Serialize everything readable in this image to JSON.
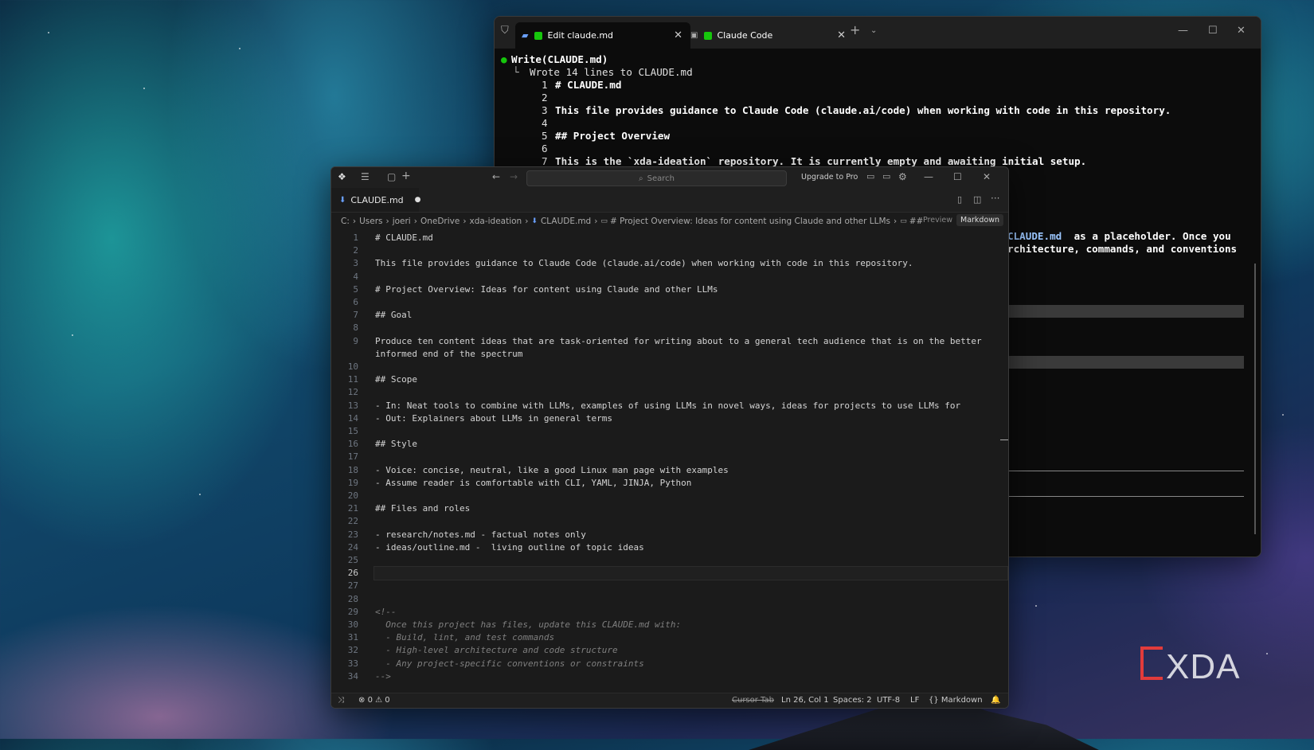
{
  "terminal": {
    "tabs": [
      {
        "label": "Edit claude.md",
        "active": true
      },
      {
        "label": "Claude Code",
        "active": false
      }
    ],
    "lines": {
      "write": "Write(CLAUDE.md)",
      "wrote": "Wrote 14 lines to CLAUDE.md",
      "numbered": [
        {
          "n": "1",
          "text": "# CLAUDE.md"
        },
        {
          "n": "2",
          "text": ""
        },
        {
          "n": "3",
          "text": "This file provides guidance to Claude Code (claude.ai/code) when working with code in this repository."
        },
        {
          "n": "4",
          "text": ""
        },
        {
          "n": "5",
          "text": "## Project Overview"
        },
        {
          "n": "6",
          "text": ""
        },
        {
          "n": "7",
          "text": "This is the `xda-ideation` repository. It is currently empty and awaiting initial setup."
        }
      ],
      "partial_1a": "CLAUDE.md",
      "partial_1b": " as a placeholder. Once you",
      "partial_2": "rchitecture, commands, and conventions"
    }
  },
  "editor": {
    "search_placeholder": "Search",
    "upgrade_label": "Upgrade to Pro",
    "file_tab": "CLAUDE.md",
    "breadcrumb": [
      "C:",
      "Users",
      "joeri",
      "OneDrive",
      "xda-ideation",
      "CLAUDE.md",
      "# Project Overview: Ideas for content using Claude and other LLMs",
      "##"
    ],
    "preview_label": "Preview",
    "markdown_label": "Markdown",
    "current_line": 26,
    "lines": [
      {
        "n": "1",
        "text": "# CLAUDE.md"
      },
      {
        "n": "2",
        "text": ""
      },
      {
        "n": "3",
        "text": "This file provides guidance to Claude Code (claude.ai/code) when working with code in this repository."
      },
      {
        "n": "4",
        "text": ""
      },
      {
        "n": "5",
        "text": "# Project Overview: Ideas for content using Claude and other LLMs"
      },
      {
        "n": "6",
        "text": ""
      },
      {
        "n": "7",
        "text": "## Goal"
      },
      {
        "n": "8",
        "text": ""
      },
      {
        "n": "9",
        "text": "Produce ten content ideas that are task-oriented for writing about to a general tech audience that is on the better"
      },
      {
        "n": "",
        "text": "informed end of the spectrum"
      },
      {
        "n": "10",
        "text": ""
      },
      {
        "n": "11",
        "text": "## Scope"
      },
      {
        "n": "12",
        "text": ""
      },
      {
        "n": "13",
        "text": "- In: Neat tools to combine with LLMs, examples of using LLMs in novel ways, ideas for projects to use LLMs for"
      },
      {
        "n": "14",
        "text": "- Out: Explainers about LLMs in general terms"
      },
      {
        "n": "15",
        "text": ""
      },
      {
        "n": "16",
        "text": "## Style"
      },
      {
        "n": "17",
        "text": ""
      },
      {
        "n": "18",
        "text": "- Voice: concise, neutral, like a good Linux man page with examples"
      },
      {
        "n": "19",
        "text": "- Assume reader is comfortable with CLI, YAML, JINJA, Python"
      },
      {
        "n": "20",
        "text": ""
      },
      {
        "n": "21",
        "text": "## Files and roles"
      },
      {
        "n": "22",
        "text": ""
      },
      {
        "n": "23",
        "text": "- research/notes.md - factual notes only"
      },
      {
        "n": "24",
        "text": "- ideas/outline.md -  living outline of topic ideas"
      },
      {
        "n": "25",
        "text": ""
      },
      {
        "n": "26",
        "text": ""
      },
      {
        "n": "27",
        "text": ""
      },
      {
        "n": "28",
        "text": ""
      },
      {
        "n": "29",
        "text": "<!--"
      },
      {
        "n": "30",
        "text": "  Once this project has files, update this CLAUDE.md with:"
      },
      {
        "n": "31",
        "text": "  - Build, lint, and test commands"
      },
      {
        "n": "32",
        "text": "  - High-level architecture and code structure"
      },
      {
        "n": "33",
        "text": "  - Any project-specific conventions or constraints"
      },
      {
        "n": "34",
        "text": "-->"
      }
    ],
    "status": {
      "errors": "0",
      "warnings": "0",
      "cursor_tab": "Cursor Tab",
      "position": "Ln 26, Col 1",
      "spaces": "Spaces: 2",
      "encoding": "UTF-8",
      "eol": "LF",
      "language": "Markdown"
    }
  },
  "watermark": "XDA"
}
